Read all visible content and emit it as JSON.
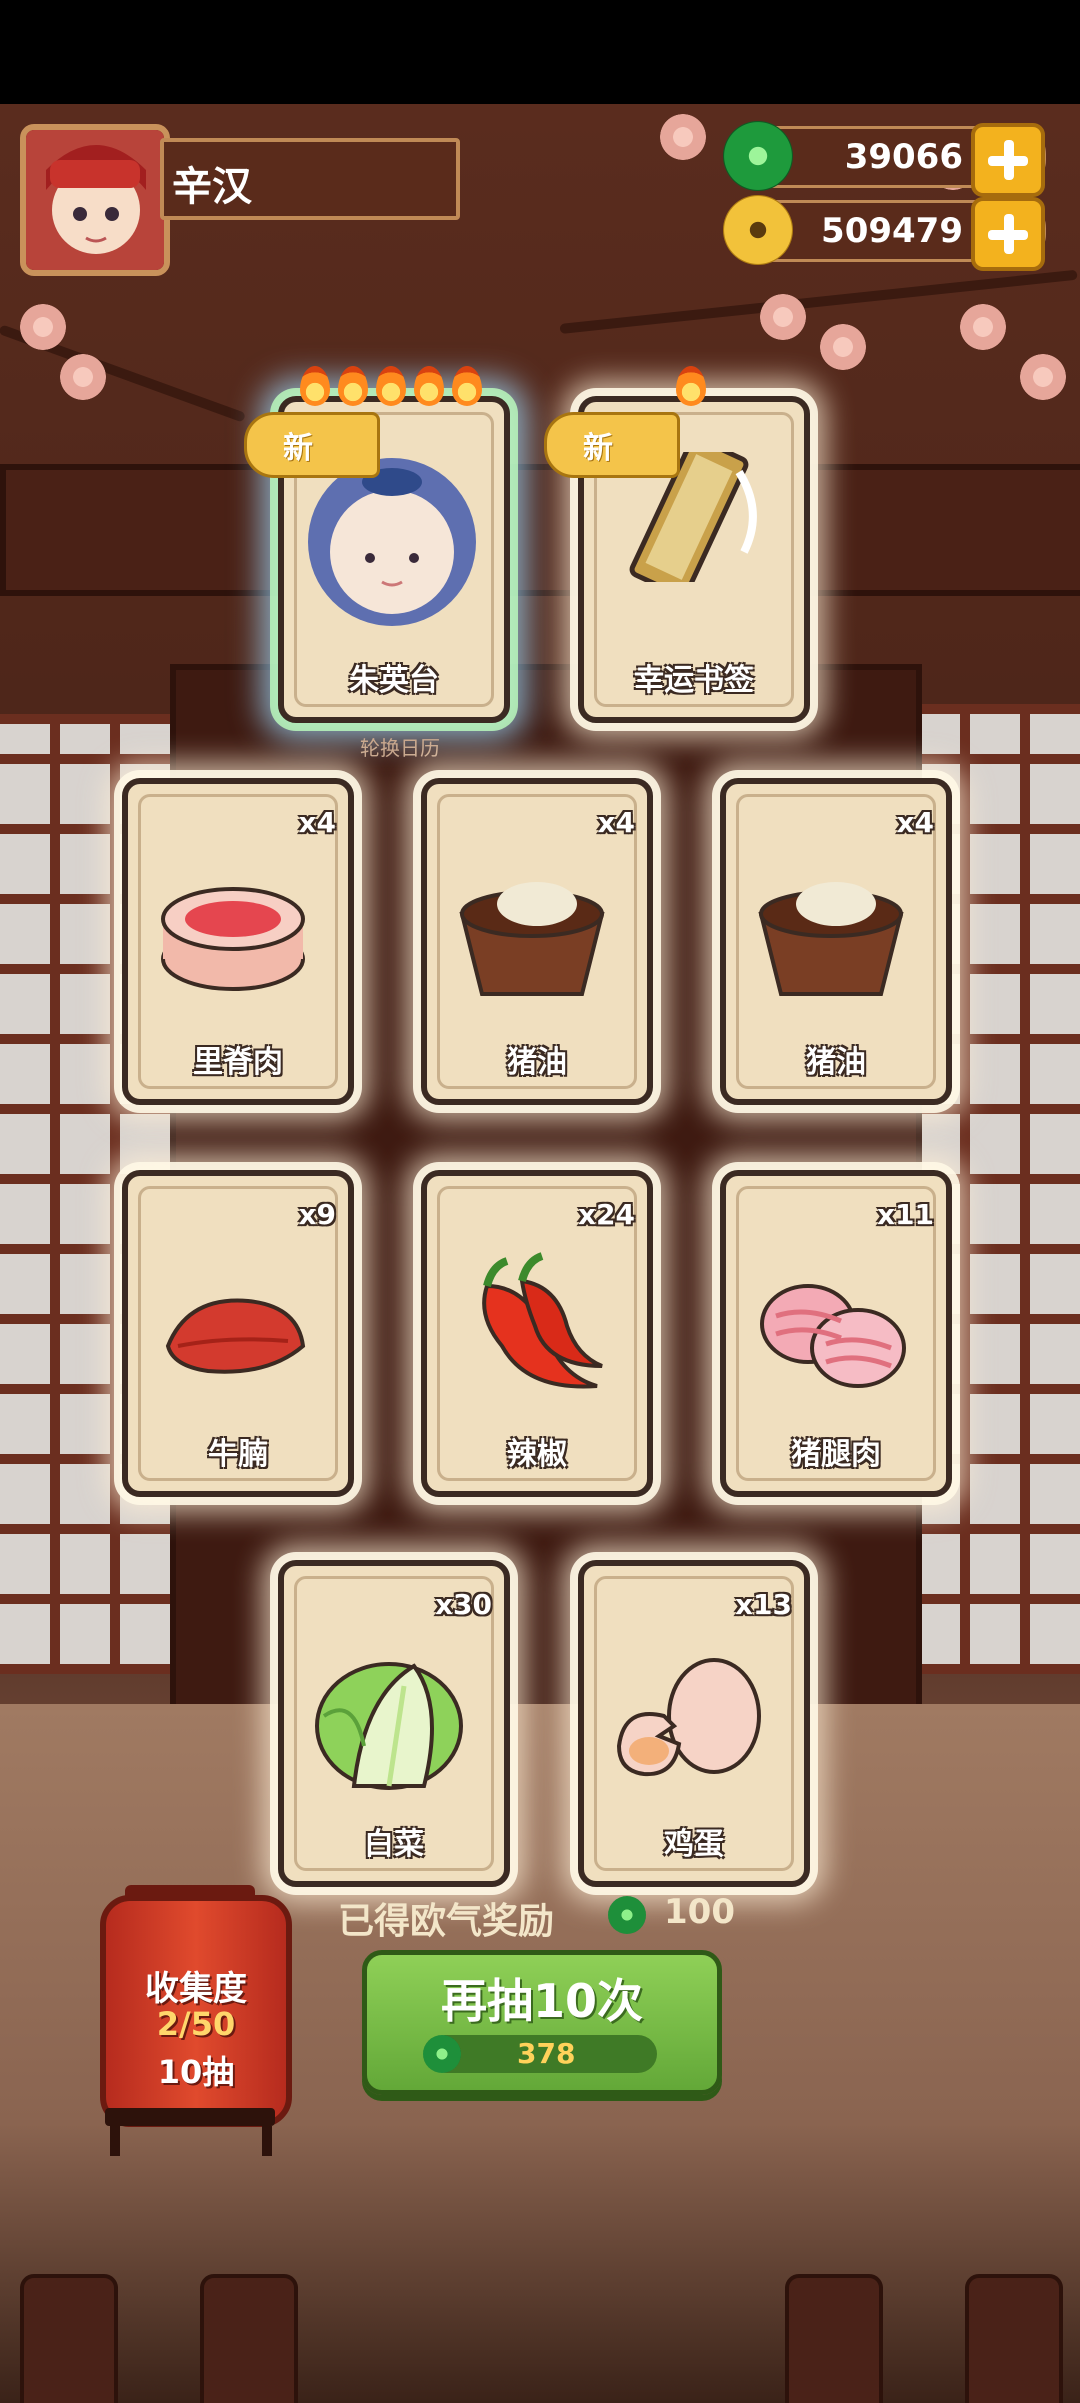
{
  "player": {
    "name": "辛汉"
  },
  "resources": {
    "jade": "39066",
    "coins": "509479"
  },
  "featured_cards": [
    {
      "label": "朱英台",
      "new_tag": "新",
      "flames": 5
    },
    {
      "label": "幸运书签",
      "new_tag": "新",
      "flames": 1
    }
  ],
  "calendar_text": "轮换日历",
  "cards": [
    {
      "label": "里脊肉",
      "count": "x4"
    },
    {
      "label": "猪油",
      "count": "x4"
    },
    {
      "label": "猪油",
      "count": "x4"
    },
    {
      "label": "牛腩",
      "count": "x9"
    },
    {
      "label": "辣椒",
      "count": "x24"
    },
    {
      "label": "猪腿肉",
      "count": "x11"
    },
    {
      "label": "白菜",
      "count": "x30"
    },
    {
      "label": "鸡蛋",
      "count": "x13"
    }
  ],
  "reward": {
    "label": "已得欧气奖励",
    "value": "100"
  },
  "collection": {
    "title": "收集度",
    "progress": "2/50",
    "draws": "10抽"
  },
  "draw_button": {
    "label": "再抽10次",
    "cost": "378"
  },
  "colors": {
    "accent_gold": "#f3b21e",
    "button_green": "#63a838",
    "lantern_red": "#d43a26"
  }
}
